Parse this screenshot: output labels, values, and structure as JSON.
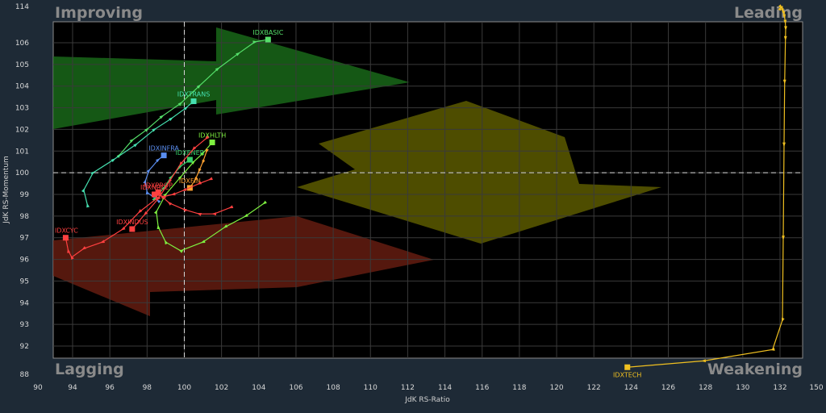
{
  "chart_data": {
    "type": "scatter",
    "title": "",
    "xlabel": "JdK RS-Ratio",
    "ylabel": "JdK RS-Momentum",
    "xlim": [
      90,
      150
    ],
    "ylim": [
      88,
      114
    ],
    "grid": true,
    "center": {
      "x": 100,
      "y": 100
    },
    "x_ticks": [
      "90",
      "94",
      "96",
      "98",
      "100",
      "102",
      "104",
      "106",
      "108",
      "110",
      "112",
      "114",
      "116",
      "118",
      "120",
      "122",
      "124",
      "126",
      "128",
      "130",
      "132",
      "150"
    ],
    "y_ticks": [
      "88",
      "92",
      "93",
      "94",
      "95",
      "96",
      "97",
      "98",
      "99",
      "100",
      "101",
      "102",
      "103",
      "104",
      "105",
      "106",
      "114"
    ],
    "quadrants": {
      "top_left": "Improving",
      "top_right": "Leading",
      "bottom_left": "Lagging",
      "bottom_right": "Weakening"
    },
    "series": [
      {
        "name": "IDXBASIC",
        "color": "#55e06a",
        "points": [
          [
            96.5,
            100.8
          ],
          [
            97.2,
            101.5
          ],
          [
            98,
            102
          ],
          [
            98.8,
            102.6
          ],
          [
            99.8,
            103.2
          ],
          [
            100.8,
            104
          ],
          [
            101.8,
            104.8
          ],
          [
            102.9,
            105.5
          ],
          [
            103.8,
            106.2
          ],
          [
            104.5,
            106.7
          ]
        ]
      },
      {
        "name": "IDXTRANS",
        "color": "#45e0b0",
        "points": [
          [
            94.8,
            98.5
          ],
          [
            94.6,
            99.2
          ],
          [
            95.1,
            100
          ],
          [
            96.2,
            100.6
          ],
          [
            97.4,
            101.3
          ],
          [
            98.4,
            102
          ],
          [
            99.3,
            102.5
          ],
          [
            100.1,
            103
          ],
          [
            100.5,
            103.3
          ]
        ]
      },
      {
        "name": "IDXHLTH",
        "color": "#7ef040",
        "points": [
          [
            104.3,
            98.6
          ],
          [
            103.3,
            98
          ],
          [
            102.2,
            97.5
          ],
          [
            101,
            96.8
          ],
          [
            99.8,
            96.4
          ],
          [
            99,
            96.8
          ],
          [
            98.6,
            97.5
          ],
          [
            98.5,
            98.2
          ],
          [
            99,
            99
          ],
          [
            99.8,
            99.8
          ],
          [
            100.5,
            100.5
          ],
          [
            101,
            100.9
          ],
          [
            101.5,
            101.4
          ]
        ]
      },
      {
        "name": "IDXINFRA",
        "color": "#5a8ef0",
        "points": [
          [
            98.6,
            98.7
          ],
          [
            98,
            99.1
          ],
          [
            97.9,
            99.6
          ],
          [
            98.1,
            100.1
          ],
          [
            98.6,
            100.6
          ],
          [
            98.9,
            100.8
          ]
        ]
      },
      {
        "name": "IDXENER",
        "color": "#36d06a",
        "points": [
          [
            98.4,
            98.8
          ],
          [
            98.9,
            99.3
          ],
          [
            99.3,
            99.8
          ],
          [
            99.8,
            100.3
          ],
          [
            100.3,
            100.6
          ]
        ]
      },
      {
        "name": "IDXPROP",
        "color": "#ff4040",
        "points": [
          [
            102.5,
            98.4
          ],
          [
            101.6,
            98.1
          ],
          [
            100.8,
            98.1
          ],
          [
            100,
            98.3
          ],
          [
            99.2,
            98.6
          ],
          [
            98.8,
            98.9
          ],
          [
            98.6,
            99.1
          ]
        ]
      },
      {
        "name": "IDXFIN",
        "color": "#ffa030",
        "points": [
          [
            101.2,
            101
          ],
          [
            101,
            100.5
          ],
          [
            100.8,
            100.1
          ],
          [
            100.6,
            99.7
          ],
          [
            100.3,
            99.3
          ]
        ]
      },
      {
        "name": "IDXNRCL",
        "color": "#ff4040",
        "points": [
          [
            101.4,
            99.7
          ],
          [
            100.8,
            99.5
          ],
          [
            100,
            99.2
          ],
          [
            99.4,
            99
          ],
          [
            98.9,
            98.9
          ],
          [
            98.4,
            99
          ]
        ]
      },
      {
        "name": "IDXINDUS",
        "color": "#ff4040",
        "points": [
          [
            101.2,
            101.6
          ],
          [
            100.5,
            101.1
          ],
          [
            99.8,
            100.4
          ],
          [
            99.2,
            99.6
          ],
          [
            98.6,
            98.8
          ],
          [
            97.9,
            98.1
          ],
          [
            97.2,
            97.4
          ]
        ]
      },
      {
        "name": "IDXCYC",
        "color": "#ff4040",
        "points": [
          [
            98.5,
            98.8
          ],
          [
            97.6,
            98.2
          ],
          [
            96.7,
            97.4
          ],
          [
            95.6,
            96.8
          ],
          [
            94.6,
            96.5
          ],
          [
            93.9,
            96.1
          ],
          [
            93.5,
            96.4
          ],
          [
            93.2,
            97
          ]
        ]
      },
      {
        "name": "IDXTECH",
        "color": "#f0c020",
        "points": [
          [
            132.1,
            113.6
          ],
          [
            132.4,
            113.9
          ],
          [
            133,
            113.6
          ],
          [
            133.4,
            113.1
          ],
          [
            133.9,
            112.5
          ],
          [
            134.2,
            111.8
          ],
          [
            134.6,
            110.6
          ],
          [
            134.8,
            109.2
          ],
          [
            134.7,
            107
          ],
          [
            134.3,
            104.2
          ],
          [
            134,
            101.3
          ],
          [
            133.6,
            97
          ],
          [
            133.2,
            93.2
          ],
          [
            131.6,
            91.5
          ],
          [
            127.9,
            89.9
          ],
          [
            123.8,
            89
          ]
        ]
      }
    ]
  }
}
